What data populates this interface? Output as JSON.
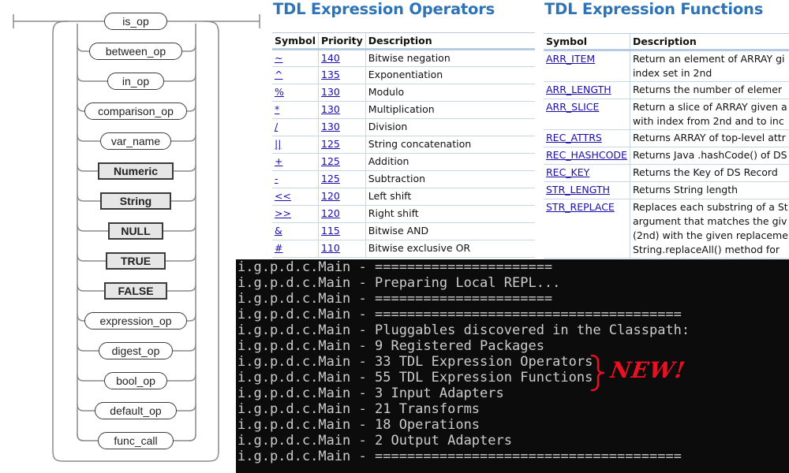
{
  "railroad": {
    "nodes": [
      {
        "label": "is_op",
        "style": "pill"
      },
      {
        "label": "between_op",
        "style": "pill"
      },
      {
        "label": "in_op",
        "style": "pill"
      },
      {
        "label": "comparison_op",
        "style": "pill"
      },
      {
        "label": "var_name",
        "style": "pill"
      },
      {
        "label": "Numeric",
        "style": "box"
      },
      {
        "label": "String",
        "style": "box"
      },
      {
        "label": "NULL",
        "style": "box"
      },
      {
        "label": "TRUE",
        "style": "box"
      },
      {
        "label": "FALSE",
        "style": "box"
      },
      {
        "label": "expression_op",
        "style": "pill"
      },
      {
        "label": "digest_op",
        "style": "pill"
      },
      {
        "label": "bool_op",
        "style": "pill"
      },
      {
        "label": "default_op",
        "style": "pill"
      },
      {
        "label": "func_call",
        "style": "pill"
      }
    ]
  },
  "operators": {
    "title": "TDL Expression Operators",
    "headers": {
      "symbol": "Symbol",
      "priority": "Priority",
      "description": "Description"
    },
    "rows": [
      {
        "symbol": "~",
        "priority": "140",
        "description": "Bitwise negation"
      },
      {
        "symbol": "^",
        "priority": "135",
        "description": "Exponentiation"
      },
      {
        "symbol": "%",
        "priority": "130",
        "description": "Modulo"
      },
      {
        "symbol": "*",
        "priority": "130",
        "description": "Multiplication"
      },
      {
        "symbol": "/",
        "priority": "130",
        "description": "Division"
      },
      {
        "symbol": "||",
        "priority": "125",
        "description": "String concatenation"
      },
      {
        "symbol": "+",
        "priority": "125",
        "description": "Addition"
      },
      {
        "symbol": "-",
        "priority": "125",
        "description": "Subtraction"
      },
      {
        "symbol": "<<",
        "priority": "120",
        "description": "Left shift"
      },
      {
        "symbol": ">>",
        "priority": "120",
        "description": "Right shift"
      },
      {
        "symbol": "&",
        "priority": "115",
        "description": "Bitwise AND"
      },
      {
        "symbol": "#",
        "priority": "110",
        "description": "Bitwise exclusive OR"
      }
    ]
  },
  "functions": {
    "title": "TDL Expression Functions",
    "headers": {
      "symbol": "Symbol",
      "description": "Description"
    },
    "rows": [
      {
        "symbol": "ARR_ITEM",
        "lines": [
          "Return an element of ARRAY gi",
          "index set in 2nd"
        ]
      },
      {
        "symbol": "ARR_LENGTH",
        "lines": [
          "Returns the number of elemer"
        ]
      },
      {
        "symbol": "ARR_SLICE",
        "lines": [
          "Return a slice of ARRAY given a",
          "with index from 2nd and to inc"
        ]
      },
      {
        "symbol": "REC_ATTRS",
        "lines": [
          "Returns ARRAY of top-level attr"
        ]
      },
      {
        "symbol": "REC_HASHCODE",
        "lines": [
          "Returns Java .hashCode() of DS"
        ]
      },
      {
        "symbol": "REC_KEY",
        "lines": [
          "Returns the Key of DS Record"
        ]
      },
      {
        "symbol": "STR_LENGTH",
        "lines": [
          "Returns String length"
        ]
      },
      {
        "symbol": "STR_REPLACE",
        "lines": [
          "Replaces each substring of a St",
          "argument that matches the giv",
          "(2nd) with the given replaceme",
          "String.replaceAll() method for"
        ]
      }
    ]
  },
  "terminal": {
    "lines": [
      "i.g.p.d.c.Main - ======================",
      "i.g.p.d.c.Main - Preparing Local REPL...",
      "i.g.p.d.c.Main - ======================",
      "i.g.p.d.c.Main - ======================================",
      "i.g.p.d.c.Main - Pluggables discovered in the Classpath:",
      "i.g.p.d.c.Main - 9 Registered Packages",
      "i.g.p.d.c.Main - 33 TDL Expression Operators",
      "i.g.p.d.c.Main - 55 TDL Expression Functions",
      "i.g.p.d.c.Main - 3 Input Adapters",
      "i.g.p.d.c.Main - 21 Transforms",
      "i.g.p.d.c.Main - 18 Operations",
      "i.g.p.d.c.Main - 2 Output Adapters",
      "i.g.p.d.c.Main - ======================================"
    ],
    "new_label": "NEW!",
    "new_color": "#e81123"
  }
}
